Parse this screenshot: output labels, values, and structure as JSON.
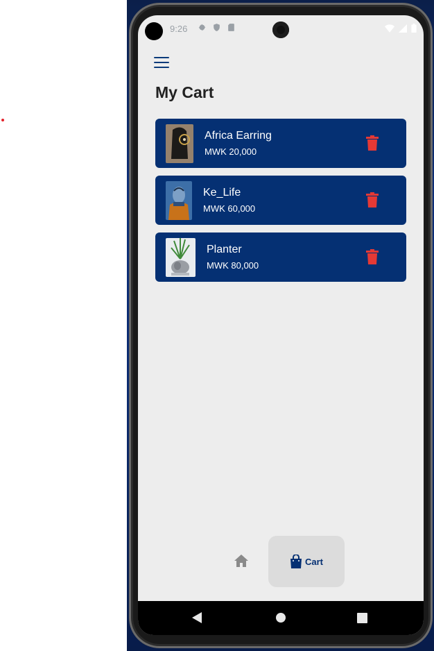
{
  "status_bar": {
    "time": "9:26"
  },
  "header": {
    "title": "My Cart"
  },
  "cart": {
    "items": [
      {
        "name": "Africa Earring",
        "price": "MWK 20,000"
      },
      {
        "name": "Ke_Life",
        "price": "MWK 60,000"
      },
      {
        "name": "Planter",
        "price": "MWK 80,000"
      }
    ]
  },
  "bottom_nav": {
    "cart_label": "Cart"
  },
  "colors": {
    "accent": "#053073",
    "card_bg": "#053073",
    "delete": "#e53935",
    "screen_bg": "#ededed"
  },
  "icons": {
    "menu": "menu-icon",
    "delete": "trash-icon",
    "home": "home-icon",
    "cart": "shopping-bag-icon"
  }
}
